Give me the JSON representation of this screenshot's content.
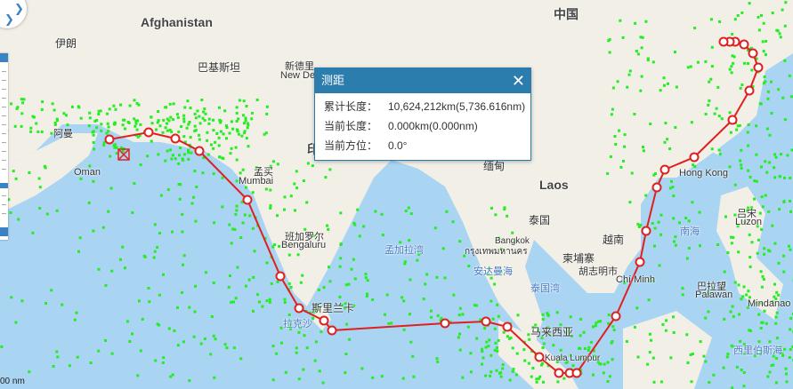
{
  "labels": {
    "china": "中国",
    "afghanistan": "Afghanistan",
    "iran": "伊朗",
    "pakistan": "巴基斯坦",
    "new_delhi_cn": "新德里",
    "new_delhi": "New De",
    "oman_cn": "阿曼",
    "oman": "Oman",
    "mumbai_cn": "孟买",
    "mumbai": "Mumbai",
    "india_partial": "印",
    "bengaluru_cn": "班加罗尔",
    "bengaluru": "Bengaluru",
    "bay_of_bengal": "孟加拉湾",
    "myanmar": "缅甸",
    "laos": "Laos",
    "thailand": "泰国",
    "bangkok_cn": "Bangkok",
    "bangkok_th": "กรุงเทพมหานคร",
    "cambodia": "柬埔寨",
    "vietnam": "越南",
    "hcmc_cn": "胡志明市",
    "hcmc": "Chí Minh",
    "hongkong": "Hong Kong",
    "luzon_cn": "吕宋",
    "luzon": "Luzon",
    "palawan_cn": "巴拉望",
    "palawan": "Palawan",
    "mindanao": "Mindanao",
    "sri_lanka": "斯里兰卡",
    "malaysia": "马来西亚",
    "kl": "Kuala Lumpur",
    "south_china_sea": "南海",
    "gulf_thailand": "泰国湾",
    "andaman": "安达曼海",
    "sulawesi_sea": "西里伯斯海",
    "maldives": "拉克沙"
  },
  "nav": {
    "zoom_in": "+",
    "zoom_out": "−"
  },
  "scale_text": "00 nm",
  "measure_panel": {
    "title": "测距",
    "close": "✕",
    "rows": [
      {
        "key": "累计长度：",
        "value": "10,624,212km(5,736.616nm)"
      },
      {
        "key": "当前长度：",
        "value": "0.000km(0.000nm)"
      },
      {
        "key": "当前方位：",
        "value": "0.0°"
      }
    ]
  },
  "colors": {
    "route": "#e02020",
    "vessel": "#22ee22",
    "sea": "#a9d4f2",
    "land": "#f2efe6",
    "panel_header": "#2a7dad"
  }
}
